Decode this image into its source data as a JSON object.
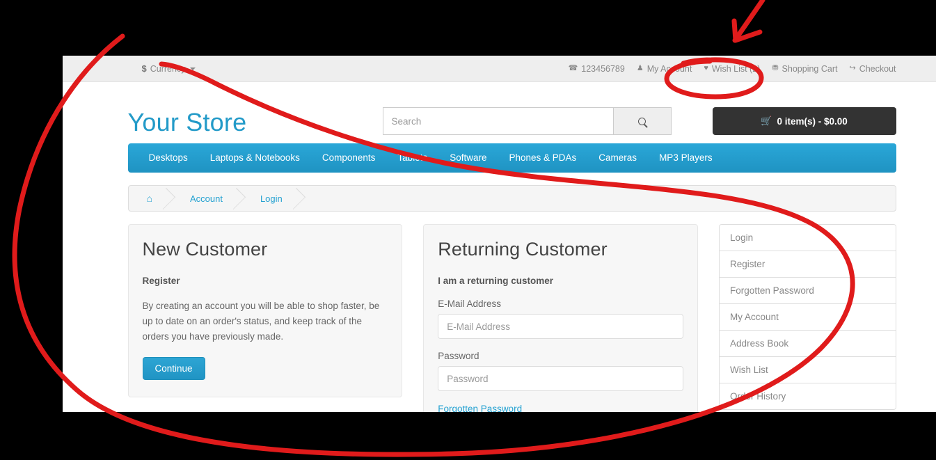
{
  "topbar": {
    "currency": {
      "symbol": "$",
      "label": "Currency"
    },
    "links": [
      {
        "icon": "phone-icon",
        "glyph": "☎",
        "label": "123456789"
      },
      {
        "icon": "user-icon",
        "glyph": "♟",
        "label": "My Account"
      },
      {
        "icon": "heart-icon",
        "glyph": "♥",
        "label": "Wish List (2)"
      },
      {
        "icon": "cart-icon",
        "glyph": "⛃",
        "label": "Shopping Cart"
      },
      {
        "icon": "share-arrow-icon",
        "glyph": "↪",
        "label": "Checkout"
      }
    ]
  },
  "header": {
    "logo": "Your Store",
    "search": {
      "placeholder": "Search",
      "value": ""
    },
    "search_button_icon": "search-icon",
    "cart_button": {
      "icon": "shopping-cart-icon",
      "label": "0 item(s) - $0.00"
    }
  },
  "nav": {
    "items": [
      "Desktops",
      "Laptops & Notebooks",
      "Components",
      "Tablets",
      "Software",
      "Phones & PDAs",
      "Cameras",
      "MP3 Players"
    ]
  },
  "breadcrumb": {
    "home_icon": "home-icon",
    "home_glyph": "⌂",
    "items": [
      "Account",
      "Login"
    ]
  },
  "new_customer": {
    "title": "New Customer",
    "subtitle": "Register",
    "body": "By creating an account you will be able to shop faster, be up to date on an order's status, and keep track of the orders you have previously made.",
    "button": "Continue"
  },
  "returning_customer": {
    "title": "Returning Customer",
    "subtitle": "I am a returning customer",
    "email_label": "E-Mail Address",
    "email_placeholder": "E-Mail Address",
    "email_value": "",
    "password_label": "Password",
    "password_placeholder": "Password",
    "password_value": "",
    "forgot_link": "Forgotten Password"
  },
  "sidebar": {
    "items": [
      "Login",
      "Register",
      "Forgotten Password",
      "My Account",
      "Address Book",
      "Wish List",
      "Order History"
    ]
  },
  "annotations": {
    "color": "#e01b1b",
    "shapes": [
      {
        "name": "wish-list-ellipse",
        "type": "ellipse",
        "target": "Wish List (2)"
      },
      {
        "name": "pointer-arrow",
        "type": "arrow",
        "target": "Wish List (2)"
      },
      {
        "name": "large-sweep-stroke",
        "type": "freehand-curve"
      }
    ]
  },
  "colors": {
    "brand_blue": "#229ac8",
    "nav_blue": "#229ac8",
    "link_blue": "#23a1d1",
    "cart_dark": "#333333",
    "topbar_grey": "#eeeeee",
    "panel_grey": "#f7f7f7",
    "annotation_red": "#e01b1b"
  }
}
